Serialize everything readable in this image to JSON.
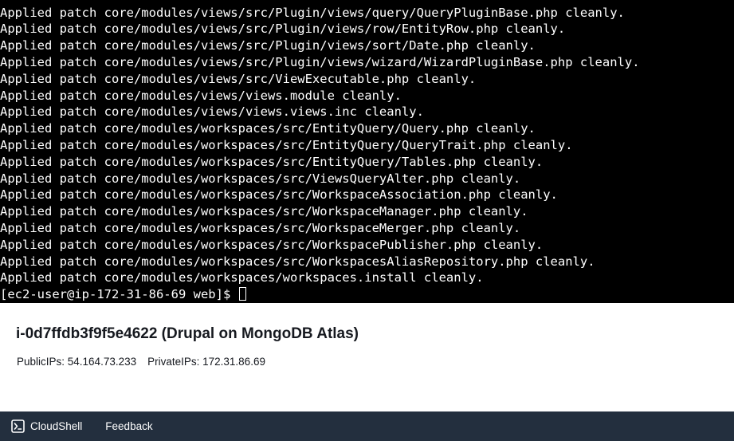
{
  "terminal": {
    "lines": [
      "Applied patch core/modules/views/src/Plugin/views/query/QueryPluginBase.php cleanly.",
      "Applied patch core/modules/views/src/Plugin/views/row/EntityRow.php cleanly.",
      "Applied patch core/modules/views/src/Plugin/views/sort/Date.php cleanly.",
      "Applied patch core/modules/views/src/Plugin/views/wizard/WizardPluginBase.php cleanly.",
      "Applied patch core/modules/views/src/ViewExecutable.php cleanly.",
      "Applied patch core/modules/views/views.module cleanly.",
      "Applied patch core/modules/views/views.views.inc cleanly.",
      "Applied patch core/modules/workspaces/src/EntityQuery/Query.php cleanly.",
      "Applied patch core/modules/workspaces/src/EntityQuery/QueryTrait.php cleanly.",
      "Applied patch core/modules/workspaces/src/EntityQuery/Tables.php cleanly.",
      "Applied patch core/modules/workspaces/src/ViewsQueryAlter.php cleanly.",
      "Applied patch core/modules/workspaces/src/WorkspaceAssociation.php cleanly.",
      "Applied patch core/modules/workspaces/src/WorkspaceManager.php cleanly.",
      "Applied patch core/modules/workspaces/src/WorkspaceMerger.php cleanly.",
      "Applied patch core/modules/workspaces/src/WorkspacePublisher.php cleanly.",
      "Applied patch core/modules/workspaces/src/WorkspacesAliasRepository.php cleanly.",
      "Applied patch core/modules/workspaces/workspaces.install cleanly."
    ],
    "prompt": "[ec2-user@ip-172-31-86-69 web]$ "
  },
  "instance": {
    "title": "i-0d7ffdb3f9f5e4622 (Drupal on MongoDB Atlas)",
    "public_ips": "PublicIPs: 54.164.73.233",
    "private_ips": "PrivateIPs: 172.31.86.69"
  },
  "footer": {
    "cloudshell_label": "CloudShell",
    "cloudshell_icon": "terminal-prompt-icon",
    "feedback_label": "Feedback"
  },
  "colors": {
    "terminal_bg": "#000000",
    "terminal_fg": "#ffffff",
    "footer_bg": "#232f3e",
    "text_dark": "#16191f"
  }
}
